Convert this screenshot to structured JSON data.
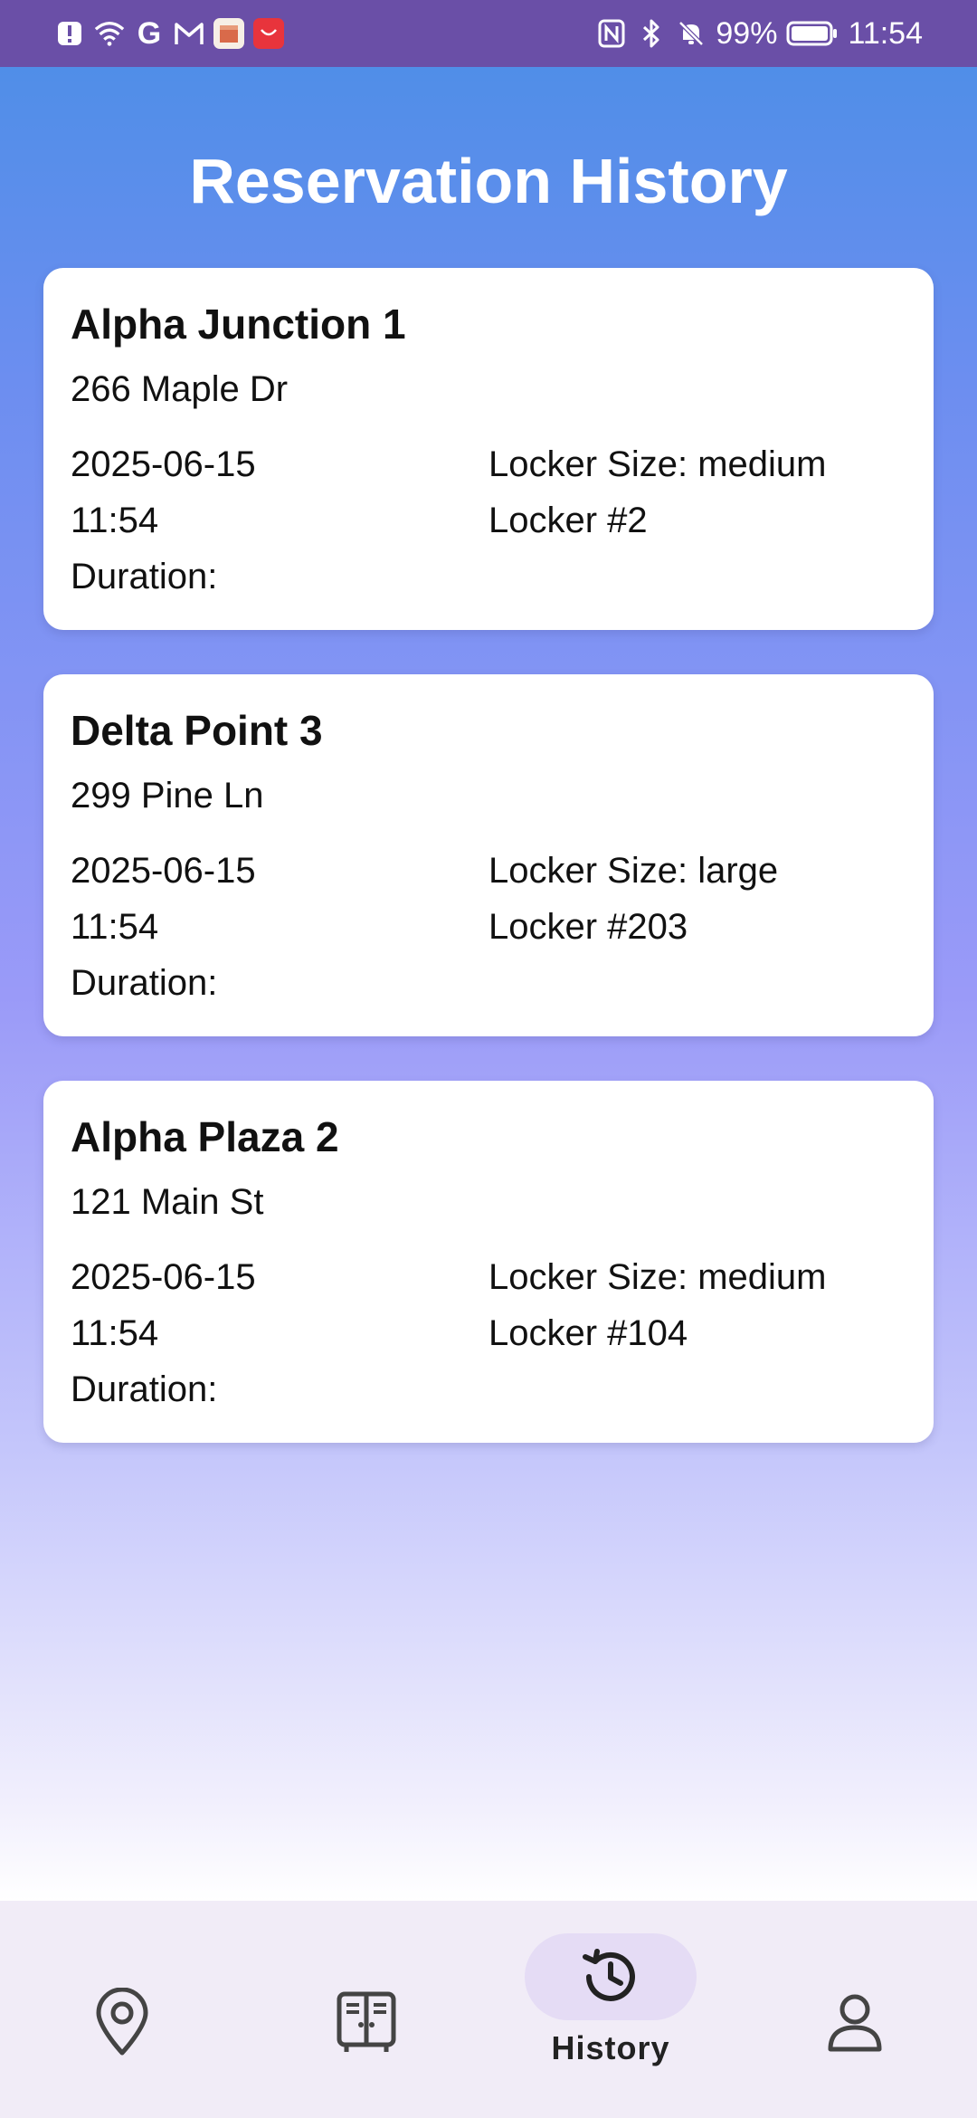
{
  "status_bar": {
    "battery": "99%",
    "time": "11:54",
    "left_icons": [
      "alert-icon",
      "wifi-icon",
      "google-icon",
      "gmail-icon",
      "app-icon",
      "huawei-app-icon"
    ],
    "right_icons": [
      "nfc-icon",
      "bluetooth-icon",
      "mute-icon",
      "battery-icon"
    ],
    "g_glyph": "G",
    "colors": {
      "bar": "#6a4fa7"
    }
  },
  "header": {
    "title": "Reservation History"
  },
  "reservations": [
    {
      "name": "Alpha Junction 1",
      "address": "266 Maple Dr",
      "date": "2025-06-15",
      "time": "11:54",
      "duration": "Duration:",
      "size": "Locker Size: medium",
      "locker": "Locker #2"
    },
    {
      "name": "Delta Point 3",
      "address": "299 Pine Ln",
      "date": "2025-06-15",
      "time": "11:54",
      "duration": "Duration:",
      "size": "Locker Size: large",
      "locker": "Locker #203"
    },
    {
      "name": "Alpha Plaza 2",
      "address": "121 Main St",
      "date": "2025-06-15",
      "time": "11:54",
      "duration": "Duration:",
      "size": "Locker Size: medium",
      "locker": "Locker #104"
    }
  ],
  "bottom_nav": {
    "items": [
      {
        "icon": "location-pin-icon",
        "label": ""
      },
      {
        "icon": "locker-icon",
        "label": ""
      },
      {
        "icon": "history-icon",
        "label": "History",
        "active": true
      },
      {
        "icon": "profile-icon",
        "label": ""
      }
    ],
    "colors": {
      "background": "#f1ecf7",
      "active_pill": "#e5dcf5"
    }
  }
}
